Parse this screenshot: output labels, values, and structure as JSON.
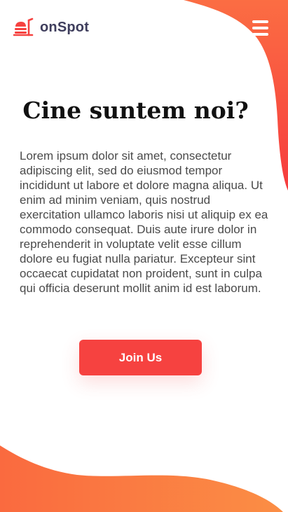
{
  "brand": {
    "name": "onSpot",
    "logo_icon": "food-tray-icon"
  },
  "header": {
    "menu_icon": "hamburger-menu-icon"
  },
  "main": {
    "title": "Cine suntem noi?",
    "body": "Lorem ipsum dolor sit amet, consectetur adipiscing elit, sed do eiusmod tempor incididunt ut labore et dolore magna aliqua. Ut enim ad minim veniam, quis nostrud exercitation ullamco laboris nisi ut aliquip ex ea commodo consequat. Duis aute irure dolor in reprehenderit in voluptate velit esse cillum dolore eu fugiat nulla pariatur. Excepteur sint occaecat cupidatat non proident, sunt in culpa qui officia deserunt mollit anim id est laborum.",
    "cta_label": "Join Us"
  },
  "colors": {
    "accent_red": "#f64240",
    "accent_orange": "#fb8e45",
    "logo_text": "#3e3d5c",
    "title": "#111111",
    "body_text": "#4a4a4a"
  }
}
